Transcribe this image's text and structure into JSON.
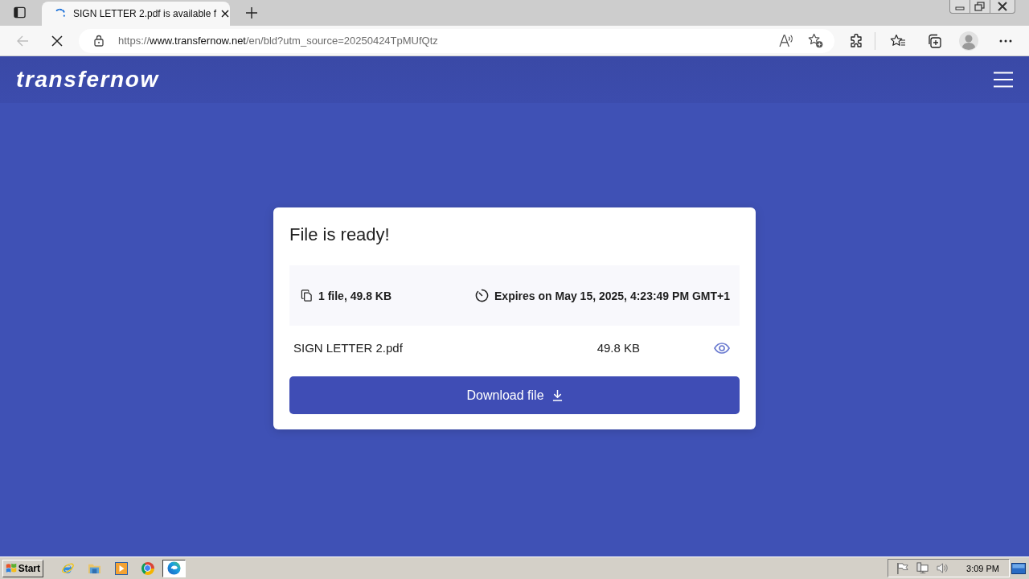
{
  "browser": {
    "tabs": [
      {
        "title": "SIGN LETTER 2.pdf is available f",
        "selected": true,
        "loading": true
      }
    ],
    "back_disabled": true,
    "address_bar": {
      "scheme": "https://",
      "host": "www.transfernow.net",
      "path": "/en/bld?utm_source=20250424TpMUfQtz"
    }
  },
  "page": {
    "logo": "transfernow",
    "card": {
      "title": "File is ready!",
      "summary": {
        "file_count": "1 file, 49.8 KB",
        "expiry": "Expires on May 15, 2025, 4:23:49 PM GMT+1"
      },
      "files": [
        {
          "name": "SIGN LETTER 2.pdf",
          "size": "49.8 KB"
        }
      ],
      "download_button": "Download file"
    }
  },
  "taskbar": {
    "start": "Start",
    "apps": [
      {
        "kind": "ie",
        "selected": false
      },
      {
        "kind": "explorer",
        "selected": false
      },
      {
        "kind": "media",
        "selected": false
      },
      {
        "kind": "chrome",
        "selected": false
      },
      {
        "kind": "edge",
        "selected": true
      }
    ],
    "clock": "3:09 PM"
  }
}
